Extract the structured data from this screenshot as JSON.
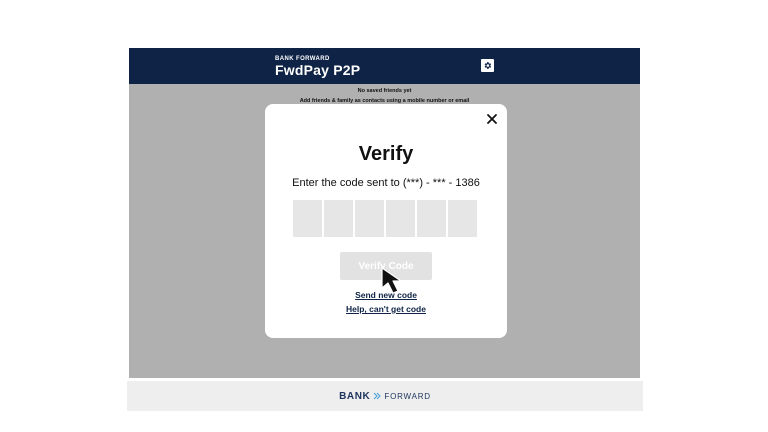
{
  "header": {
    "brand": "BANK FORWARD",
    "title": "FwdPay P2P",
    "settings_icon": "gear-icon"
  },
  "empty_state": {
    "title": "No saved friends yet",
    "subtitle": "Add friends & family as contacts using a mobile number or email"
  },
  "modal": {
    "title": "Verify",
    "subtitle": "Enter the code sent to (***) - *** - 1386",
    "code_boxes": [
      "",
      "",
      "",
      "",
      "",
      ""
    ],
    "verify_button": "Verify Code",
    "send_new_code": "Send new code",
    "help_link": "Help, can't get code",
    "close_icon": "close-icon"
  },
  "footer": {
    "logo_left": "BANK",
    "logo_right": "FORWARD"
  },
  "colors": {
    "header_bg": "#0f2346",
    "overlay_bg": "#b0b0b0",
    "link": "#0f2346",
    "button_disabled_bg": "#e2e2e2",
    "code_box_bg": "#e6e6e6"
  }
}
